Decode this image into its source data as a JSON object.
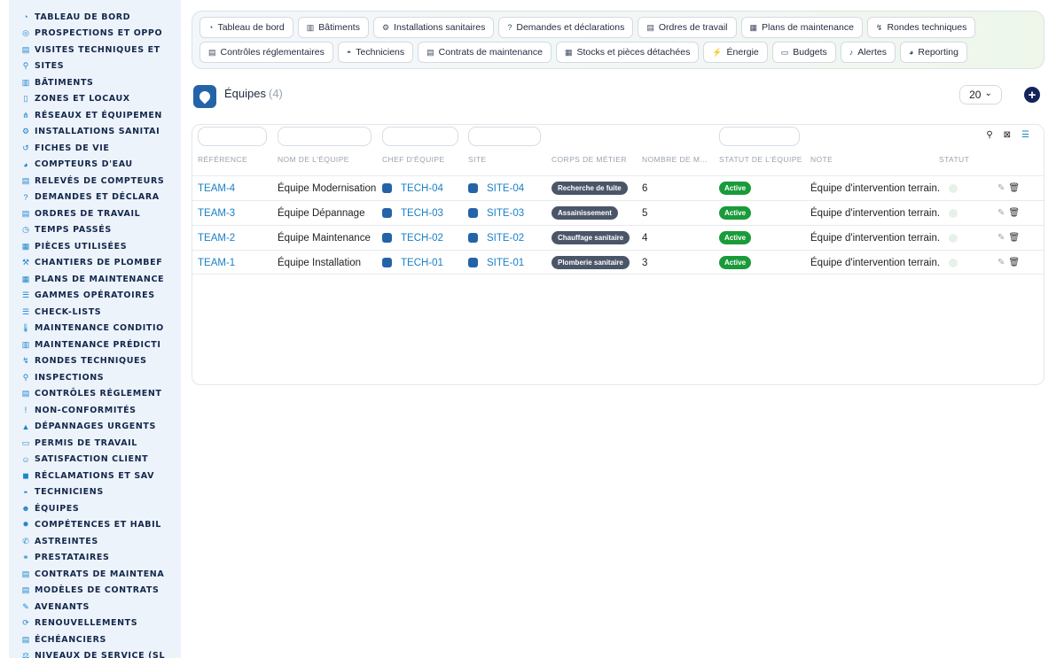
{
  "sidebar": {
    "items": [
      {
        "label": "TABLEAU DE BORD",
        "icon": "dashboard-icon",
        "glyph": "◔"
      },
      {
        "label": "PROSPECTIONS ET OPPO",
        "icon": "target-icon",
        "glyph": "◎"
      },
      {
        "label": "VISITES TECHNIQUES ET",
        "icon": "clipboard-icon",
        "glyph": "▤"
      },
      {
        "label": "SITES",
        "icon": "map-pin-icon",
        "glyph": "⚲"
      },
      {
        "label": "BÂTIMENTS",
        "icon": "building-icon",
        "glyph": "▥"
      },
      {
        "label": "ZONES ET LOCAUX",
        "icon": "door-icon",
        "glyph": "▯"
      },
      {
        "label": "RÉSEAUX ET ÉQUIPEMEN",
        "icon": "network-icon",
        "glyph": "⋔"
      },
      {
        "label": "INSTALLATIONS SANITAI",
        "icon": "gears-icon",
        "glyph": "⚙"
      },
      {
        "label": "FICHES DE VIE",
        "icon": "history-icon",
        "glyph": "↺"
      },
      {
        "label": "COMPTEURS D'EAU",
        "icon": "gauge-icon",
        "glyph": "◕"
      },
      {
        "label": "RELEVÉS DE COMPTEURS",
        "icon": "clipboard-check-icon",
        "glyph": "▤"
      },
      {
        "label": "DEMANDES ET DÉCLARA",
        "icon": "question-icon",
        "glyph": "?"
      },
      {
        "label": "ORDRES DE TRAVAIL",
        "icon": "clipboard-list-icon",
        "glyph": "▤"
      },
      {
        "label": "TEMPS PASSÉS",
        "icon": "clock-icon",
        "glyph": "◷"
      },
      {
        "label": "PIÈCES UTILISÉES",
        "icon": "boxes-icon",
        "glyph": "▦"
      },
      {
        "label": "CHANTIERS DE PLOMBEF",
        "icon": "hammer-icon",
        "glyph": "⚒"
      },
      {
        "label": "PLANS DE MAINTENANCE",
        "icon": "calendar-icon",
        "glyph": "▦"
      },
      {
        "label": "GAMMES OPÉRATOIRES",
        "icon": "list-icon",
        "glyph": "☰"
      },
      {
        "label": "CHECK-LISTS",
        "icon": "checklist-icon",
        "glyph": "☰"
      },
      {
        "label": "MAINTENANCE CONDITIO",
        "icon": "thermometer-icon",
        "glyph": "🌡"
      },
      {
        "label": "MAINTENANCE PRÉDICTI",
        "icon": "chart-icon",
        "glyph": "▥"
      },
      {
        "label": "RONDES TECHNIQUES",
        "icon": "route-icon",
        "glyph": "↯"
      },
      {
        "label": "INSPECTIONS",
        "icon": "magnifier-icon",
        "glyph": "⚲"
      },
      {
        "label": "CONTRÔLES RÉGLEMENT",
        "icon": "clipboard-icon",
        "glyph": "▤"
      },
      {
        "label": "NON-CONFORMITÉS",
        "icon": "alert-circle-icon",
        "glyph": "!"
      },
      {
        "label": "DÉPANNAGES URGENTS",
        "icon": "warning-icon",
        "glyph": "▲"
      },
      {
        "label": "PERMIS DE TRAVAIL",
        "icon": "id-card-icon",
        "glyph": "▭"
      },
      {
        "label": "SATISFACTION CLIENT",
        "icon": "smile-icon",
        "glyph": "☺"
      },
      {
        "label": "RÉCLAMATIONS ET SAV",
        "icon": "comment-icon",
        "glyph": "◼"
      },
      {
        "label": "TECHNICIENS",
        "icon": "hard-hat-icon",
        "glyph": "◓"
      },
      {
        "label": "ÉQUIPES",
        "icon": "users-icon",
        "glyph": "☻"
      },
      {
        "label": "COMPÉTENCES ET HABIL",
        "icon": "certificate-icon",
        "glyph": "✸"
      },
      {
        "label": "ASTREINTES",
        "icon": "phone-icon",
        "glyph": "✆"
      },
      {
        "label": "PRESTATAIRES",
        "icon": "handshake-icon",
        "glyph": "⚭"
      },
      {
        "label": "CONTRATS DE MAINTENA",
        "icon": "file-contract-icon",
        "glyph": "▤"
      },
      {
        "label": "MODÈLES DE CONTRATS",
        "icon": "file-icon",
        "glyph": "▤"
      },
      {
        "label": "AVENANTS",
        "icon": "file-edit-icon",
        "glyph": "✎"
      },
      {
        "label": "RENOUVELLEMENTS",
        "icon": "sync-icon",
        "glyph": "⟳"
      },
      {
        "label": "ÉCHÉANCIERS",
        "icon": "file-invoice-icon",
        "glyph": "▤"
      },
      {
        "label": "NIVEAUX DE SERVICE (SL",
        "icon": "scale-icon",
        "glyph": "⚖"
      }
    ]
  },
  "topnav": {
    "row1": [
      {
        "label": "Tableau de bord",
        "icon": "dashboard-icon",
        "glyph": "◔"
      },
      {
        "label": "Bâtiments",
        "icon": "building-icon",
        "glyph": "▥"
      },
      {
        "label": "Installations sanitaires",
        "icon": "gears-icon",
        "glyph": "⚙"
      },
      {
        "label": "Demandes et déclarations",
        "icon": "question-icon",
        "glyph": "?"
      },
      {
        "label": "Ordres de travail",
        "icon": "clipboard-list-icon",
        "glyph": "▤"
      },
      {
        "label": "Plans de maintenance",
        "icon": "calendar-icon",
        "glyph": "▦"
      },
      {
        "label": "Rondes techniques",
        "icon": "route-icon",
        "glyph": "↯"
      }
    ],
    "row2": [
      {
        "label": "Contrôles réglementaires",
        "icon": "clipboard-check-icon",
        "glyph": "▤"
      },
      {
        "label": "Techniciens",
        "icon": "hard-hat-icon",
        "glyph": "◓"
      },
      {
        "label": "Contrats de maintenance",
        "icon": "file-contract-icon",
        "glyph": "▤"
      },
      {
        "label": "Stocks et pièces détachées",
        "icon": "boxes-icon",
        "glyph": "▦"
      },
      {
        "label": "Énergie",
        "icon": "bolt-icon",
        "glyph": "⚡"
      },
      {
        "label": "Budgets",
        "icon": "money-icon",
        "glyph": "▭"
      },
      {
        "label": "Alertes",
        "icon": "bell-icon",
        "glyph": "♪"
      },
      {
        "label": "Reporting",
        "icon": "pie-chart-icon",
        "glyph": "◕"
      }
    ]
  },
  "page": {
    "title": "Équipes",
    "count": "(4)",
    "page_size": "20",
    "page_size_caret": "⌄",
    "add_glyph": "+"
  },
  "toolbar": {
    "search_glyph": "⚲",
    "clear_filter_glyph": "⊠",
    "list_view_glyph": "☰"
  },
  "table": {
    "columns": [
      "RÉFÉRENCE",
      "NOM DE L'ÉQUIPE",
      "CHEF D'ÉQUIPE",
      "SITE",
      "CORPS DE MÉTIER",
      "NOMBRE DE M…",
      "STATUT DE L'ÉQUIPE",
      "NOTE",
      "STATUT"
    ],
    "rows": [
      {
        "ref": "TEAM-4",
        "name": "Équipe Modernisation",
        "chef": "TECH-04",
        "site": "SITE-04",
        "metier": "Recherche de fuite",
        "nombre": "6",
        "statut_equipe": "Active",
        "note": "Équipe d'intervention terrain."
      },
      {
        "ref": "TEAM-3",
        "name": "Équipe Dépannage",
        "chef": "TECH-03",
        "site": "SITE-03",
        "metier": "Assainissement",
        "nombre": "5",
        "statut_equipe": "Active",
        "note": "Équipe d'intervention terrain."
      },
      {
        "ref": "TEAM-2",
        "name": "Équipe Maintenance",
        "chef": "TECH-02",
        "site": "SITE-02",
        "metier": "Chauffage sanitaire",
        "nombre": "4",
        "statut_equipe": "Active",
        "note": "Équipe d'intervention terrain."
      },
      {
        "ref": "TEAM-1",
        "name": "Équipe Installation",
        "chef": "TECH-01",
        "site": "SITE-01",
        "metier": "Plomberie sanitaire",
        "nombre": "3",
        "statut_equipe": "Active",
        "note": "Équipe d'intervention terrain."
      }
    ],
    "edit_glyph": "✎",
    "delete_glyph": "🗑"
  },
  "colors": {
    "accent": "#1a7fc7",
    "sidebar_bg": "#edf3fb",
    "active_badge": "#1a9b3a",
    "metier_badge": "#4a5668",
    "add_button": "#14235a"
  }
}
